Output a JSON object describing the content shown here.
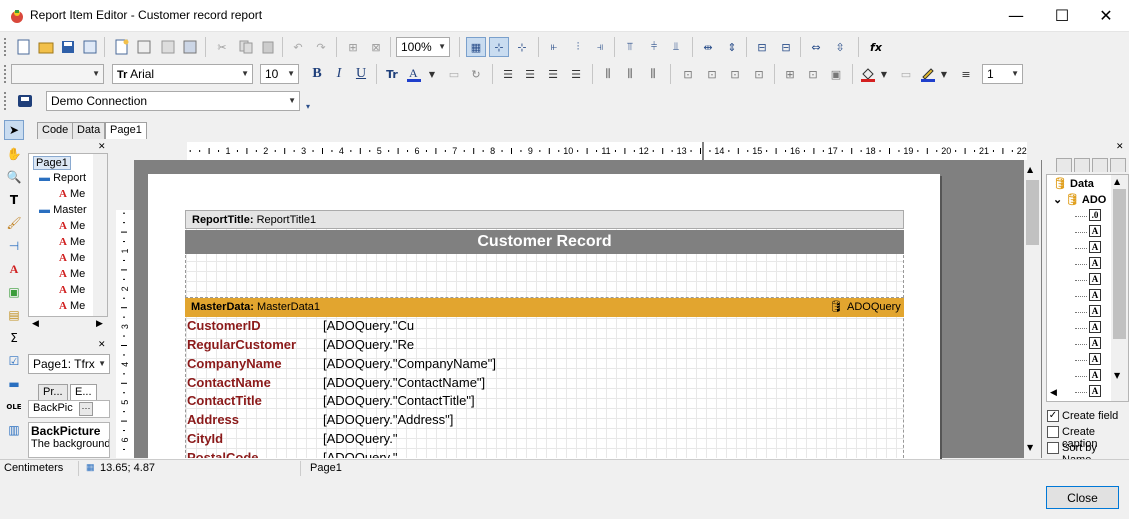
{
  "window": {
    "title": "Report Item Editor - Customer record report",
    "minimize": "—",
    "maximize": "☐",
    "close": "✕"
  },
  "toolbar1": {
    "zoom": "100%"
  },
  "toolbar2": {
    "style": "",
    "font_name": "Arial",
    "font_size": "10",
    "bold": "B",
    "italic": "I",
    "underline": "U",
    "line_width": "1"
  },
  "toolbar3": {
    "connection": "Demo Connection"
  },
  "tabs": [
    {
      "label": "Code"
    },
    {
      "label": "Data"
    },
    {
      "label": "Page1"
    }
  ],
  "tree": {
    "root": "Page1",
    "items": [
      {
        "label": "Report",
        "kind": "band"
      },
      {
        "label": "Me",
        "kind": "memo"
      },
      {
        "label": "Master",
        "kind": "band"
      },
      {
        "label": "Me",
        "kind": "memo"
      },
      {
        "label": "Me",
        "kind": "memo"
      },
      {
        "label": "Me",
        "kind": "memo"
      },
      {
        "label": "Me",
        "kind": "memo"
      },
      {
        "label": "Me",
        "kind": "memo"
      },
      {
        "label": "Me",
        "kind": "memo"
      }
    ]
  },
  "object_inspector": {
    "selected": "Page1: Tfrx",
    "tab_props": "Pr...",
    "tab_events": "E...",
    "property_name": "BackPic",
    "property_button": "···",
    "help_title": "BackPicture",
    "help_text": "The background"
  },
  "report": {
    "title_band_label": "ReportTitle:",
    "title_band_name": "ReportTitle1",
    "title_text": "Customer Record",
    "master_band_label": "MasterData:",
    "master_band_name": "MasterData1",
    "master_dataset": "ADOQuery",
    "fields": [
      {
        "label": "CustomerID",
        "value": "[ADOQuery.\"Cu"
      },
      {
        "label": "RegularCustomer",
        "value": "[ADOQuery.\"Re"
      },
      {
        "label": "CompanyName",
        "value": "[ADOQuery.\"CompanyName\"]"
      },
      {
        "label": "ContactName",
        "value": "[ADOQuery.\"ContactName\"]"
      },
      {
        "label": "ContactTitle",
        "value": "[ADOQuery.\"ContactTitle\"]"
      },
      {
        "label": "Address",
        "value": "[ADOQuery.\"Address\"]"
      },
      {
        "label": "CityId",
        "value": "[ADOQuery.\""
      },
      {
        "label": "PostalCode",
        "value": "[ADOQuery.\""
      }
    ]
  },
  "ruler": {
    "h_ticks": [
      "1",
      "2",
      "3",
      "4",
      "5",
      "6",
      "7",
      "8",
      "9",
      "10",
      "11",
      "12",
      "13",
      "14",
      "15",
      "16",
      "17",
      "18",
      "19",
      "20",
      "21",
      "22"
    ],
    "v_ticks": [
      "1",
      "2",
      "3",
      "4",
      "5",
      "6"
    ]
  },
  "data_panel": {
    "root": "Data",
    "dataset": "ADO",
    "field_count": 12,
    "create_field": "Create field",
    "create_caption": "Create caption",
    "sort_by_name": "Sort by Name",
    "create_field_checked": true,
    "create_caption_checked": false,
    "sort_by_name_checked": false
  },
  "statusbar": {
    "units": "Centimeters",
    "coords": "13.65; 4.87",
    "page": "Page1"
  },
  "buttons": {
    "close": "Close"
  }
}
